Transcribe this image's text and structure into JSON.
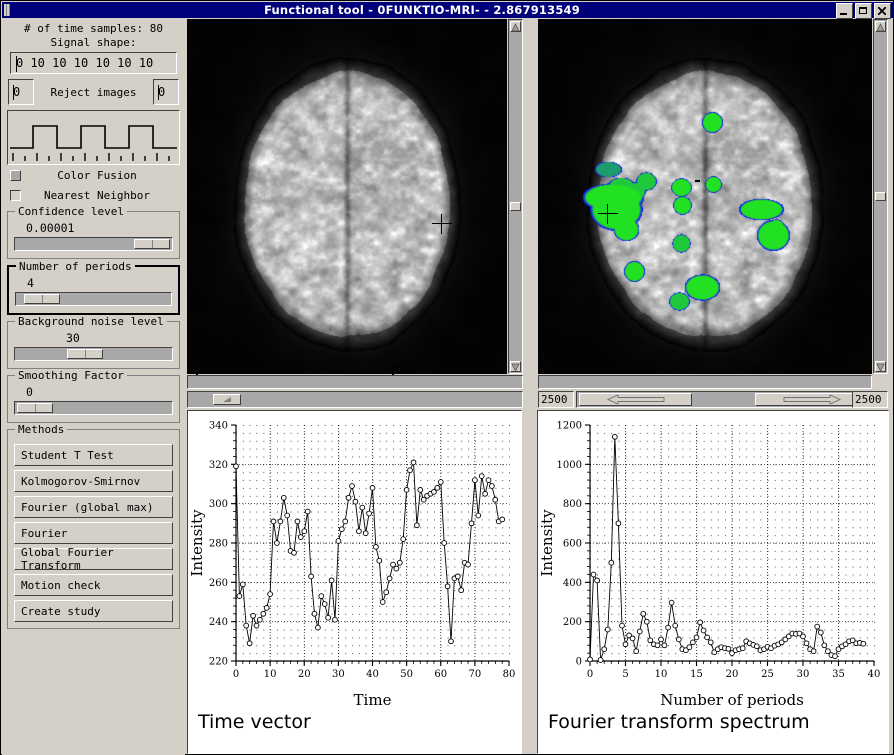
{
  "window": {
    "title": "Functional tool - 0FUNKTIO-MRI- - 2.867913549",
    "minimize_icon": "minimize-icon",
    "maximize_icon": "maximize-icon",
    "close_icon": "close-icon"
  },
  "controls": {
    "time_samples_label": "# of time samples: 80",
    "signal_shape_label": "Signal shape:",
    "signal_shape_value": "0 10 10 10 10 10 10",
    "reject_images_label": "Reject images",
    "reject_left_value": "0",
    "reject_right_value": "0",
    "color_fusion_label": "Color Fusion",
    "color_fusion_checked": true,
    "nearest_neighbor_label": "Nearest Neighbor",
    "nearest_neighbor_checked": false,
    "confidence_level_label": "Confidence level",
    "confidence_level_value": "0.00001",
    "number_of_periods_label": "Number of periods",
    "number_of_periods_value": "4",
    "background_noise_label": "Background noise level",
    "background_noise_value": "30",
    "smoothing_factor_label": "Smoothing Factor",
    "smoothing_factor_value": "0"
  },
  "methods": {
    "title": "Methods",
    "items": [
      "Student T Test",
      "Kolmogorov-Smirnov",
      "Fourier (global max)",
      "Fourier",
      "Global Fourier Transform",
      "Motion check",
      "Create study"
    ]
  },
  "viewers": {
    "left_name": "anatomical-slice-view",
    "right_name": "activation-overlay-view",
    "overlay_color_core": "#22e022",
    "overlay_color_edge": "#1414ff"
  },
  "toolbar": {
    "left_value": "2500",
    "right_value": "2500",
    "prev_icon": "arrow-left-icon",
    "next_icon": "arrow-right-icon"
  },
  "chart_data": [
    {
      "type": "line",
      "name": "time-vector-chart",
      "title": "Time vector",
      "xlabel": "Time",
      "ylabel": "Intensity",
      "xlim": [
        0,
        80
      ],
      "ylim": [
        220,
        340
      ],
      "xticks": [
        0,
        10,
        20,
        30,
        40,
        50,
        60,
        70,
        80
      ],
      "yticks": [
        220,
        240,
        260,
        280,
        300,
        320,
        340
      ],
      "grid": true,
      "marker": "circle",
      "x": [
        0,
        1,
        2,
        3,
        4,
        5,
        6,
        7,
        8,
        9,
        10,
        11,
        12,
        13,
        14,
        15,
        16,
        17,
        18,
        19,
        20,
        21,
        22,
        23,
        24,
        25,
        26,
        27,
        28,
        29,
        30,
        31,
        32,
        33,
        34,
        35,
        36,
        37,
        38,
        39,
        40,
        41,
        42,
        43,
        44,
        45,
        46,
        47,
        48,
        49,
        50,
        51,
        52,
        53,
        54,
        55,
        56,
        57,
        58,
        59,
        60,
        61,
        62,
        63,
        64,
        65,
        66,
        67,
        68,
        69,
        70,
        71,
        72,
        73,
        74,
        75,
        76,
        77,
        78
      ],
      "values": [
        319,
        253,
        259,
        238,
        229,
        243,
        238,
        241,
        244,
        247,
        254,
        291,
        280,
        291,
        303,
        294,
        276,
        275,
        291,
        283,
        286,
        296,
        263,
        244,
        237,
        253,
        249,
        242,
        261,
        241,
        281,
        287,
        291,
        303,
        309,
        301,
        286,
        298,
        285,
        295,
        308,
        278,
        271,
        250,
        255,
        262,
        269,
        267,
        270,
        282,
        307,
        317,
        321,
        289,
        307,
        302,
        304,
        305,
        306,
        308,
        311,
        280,
        258,
        230,
        262,
        263,
        256,
        270,
        269,
        290,
        312,
        294,
        314,
        305,
        312,
        309,
        302,
        291,
        292
      ]
    },
    {
      "type": "line",
      "name": "fourier-spectrum-chart",
      "title": "Fourier transform spectrum",
      "xlabel": "Number of periods",
      "ylabel": "Intensity",
      "xlim": [
        0,
        40
      ],
      "ylim": [
        0,
        1200
      ],
      "xticks": [
        0,
        5,
        10,
        15,
        20,
        25,
        30,
        35,
        40
      ],
      "yticks": [
        0,
        200,
        400,
        600,
        800,
        1000,
        1200
      ],
      "grid": true,
      "marker": "circle",
      "x": [
        0,
        0.5,
        1,
        1.5,
        2,
        2.5,
        3,
        3.5,
        4,
        4.5,
        5,
        5.5,
        6,
        6.5,
        7,
        7.5,
        8,
        8.5,
        9,
        9.5,
        10,
        10.5,
        11,
        11.5,
        12,
        12.5,
        13,
        13.5,
        14,
        14.5,
        15,
        15.5,
        16,
        16.5,
        17,
        17.5,
        18,
        18.5,
        19,
        19.5,
        20,
        20.5,
        21,
        21.5,
        22,
        22.5,
        23,
        23.5,
        24,
        24.5,
        25,
        25.5,
        26,
        26.5,
        27,
        27.5,
        28,
        28.5,
        29,
        29.5,
        30,
        30.5,
        31,
        31.5,
        32,
        32.5,
        33,
        33.5,
        34,
        34.5,
        35,
        35.5,
        36,
        36.5,
        37,
        37.5,
        38,
        38.5
      ],
      "values": [
        8,
        440,
        410,
        5,
        60,
        160,
        500,
        1140,
        700,
        180,
        85,
        130,
        115,
        50,
        150,
        240,
        200,
        105,
        85,
        80,
        110,
        80,
        170,
        297,
        180,
        110,
        60,
        55,
        70,
        95,
        120,
        197,
        155,
        120,
        95,
        45,
        60,
        70,
        65,
        62,
        40,
        55,
        60,
        65,
        100,
        90,
        82,
        75,
        55,
        60,
        72,
        65,
        78,
        85,
        95,
        110,
        125,
        140,
        138,
        140,
        125,
        90,
        60,
        50,
        175,
        145,
        80,
        50,
        30,
        25,
        60,
        75,
        85,
        100,
        105,
        90,
        92,
        88
      ]
    }
  ]
}
